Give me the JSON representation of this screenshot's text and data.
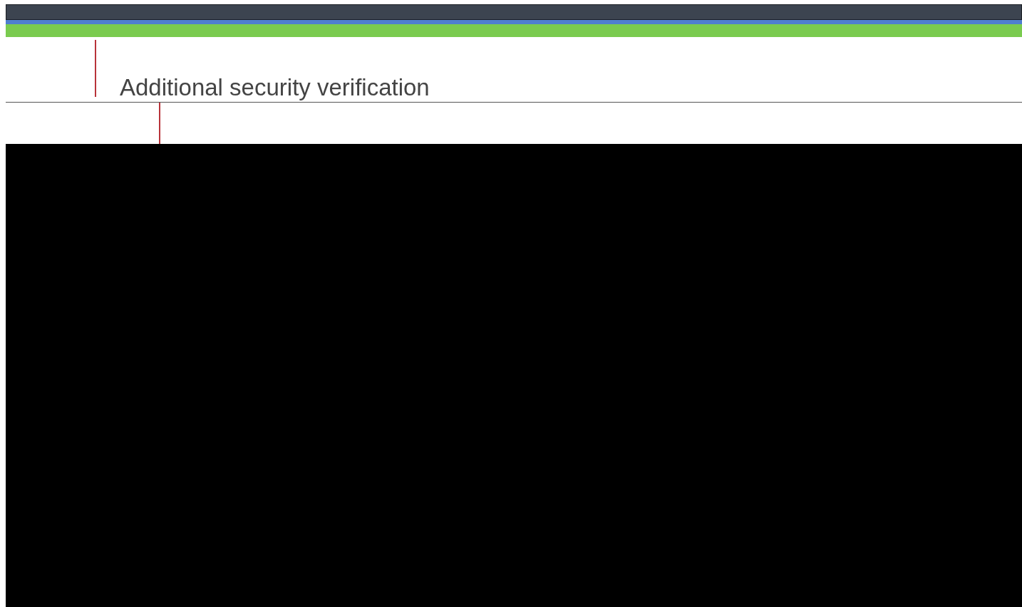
{
  "page": {
    "heading": "Additional security verification"
  }
}
